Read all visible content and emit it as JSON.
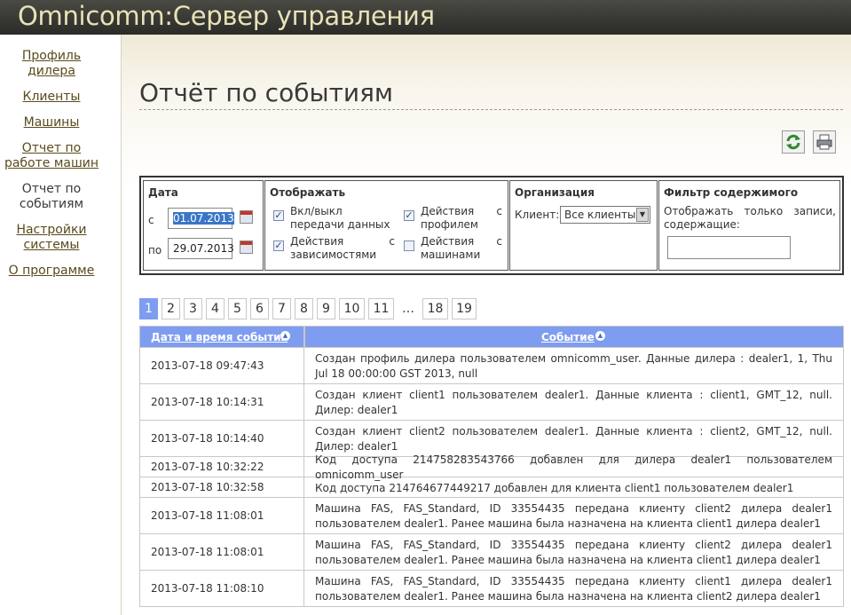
{
  "header": {
    "title": "Omnicomm:Сервер управления"
  },
  "sidebar": {
    "items": [
      {
        "label": "Профиль дилера"
      },
      {
        "label": "Клиенты"
      },
      {
        "label": "Машины"
      },
      {
        "label": "Отчет по работе машин"
      },
      {
        "label": "Отчет по событиям"
      },
      {
        "label": "Настройки системы"
      },
      {
        "label": "О программе"
      }
    ]
  },
  "page": {
    "title": "Отчёт по событиям"
  },
  "toolbar": {
    "refresh_icon": "refresh-icon",
    "print_icon": "print-icon"
  },
  "filters": {
    "date": {
      "heading": "Дата",
      "from_label": "с",
      "from_value": "01.07.2013",
      "to_label": "по",
      "to_value": "29.07.2013"
    },
    "display": {
      "heading": "Отображать",
      "options": [
        {
          "label": "Вкл/выкл передачи данных",
          "checked": true
        },
        {
          "label": "Действия с профилем",
          "checked": true
        },
        {
          "label": "Действия с зависимостями",
          "checked": true
        },
        {
          "label": "Действия с машинами",
          "checked": false
        }
      ]
    },
    "organization": {
      "heading": "Организация",
      "client_label": "Клиент:",
      "client_value": "Все клиенты"
    },
    "content": {
      "heading": "Фильтр содержимого",
      "description": "Отображать только записи, содержащие:",
      "value": ""
    }
  },
  "pagination": {
    "pages": [
      "1",
      "2",
      "3",
      "4",
      "5",
      "6",
      "7",
      "8",
      "9",
      "10",
      "11"
    ],
    "ellipsis": "…",
    "last_pages": [
      "18",
      "19"
    ],
    "current": "1"
  },
  "table": {
    "columns": [
      "Дата и время события",
      "Событие"
    ],
    "rows": [
      {
        "date": "2013-07-18 09:47:43",
        "event": "Создан профиль дилера пользователем omnicomm_user. Данные дилера : dealer1, 1, Thu Jul 18 00:00:00 GST 2013, null"
      },
      {
        "date": "2013-07-18 10:14:31",
        "event": "Создан клиент client1 пользователем dealer1. Данные клиента : client1, GMT_12, null. Дилер: dealer1"
      },
      {
        "date": "2013-07-18 10:14:40",
        "event": "Создан клиент client2 пользователем dealer1. Данные клиента : client2, GMT_12, null. Дилер: dealer1"
      },
      {
        "date": "2013-07-18 10:32:22",
        "event": "Код доступа 214758283543766 добавлен для дилера dealer1 пользователем omnicomm_user"
      },
      {
        "date": "2013-07-18 10:32:58",
        "event": "Код доступа 214764677449217 добавлен для клиента client1 пользователем dealer1"
      },
      {
        "date": "2013-07-18 11:08:01",
        "event": "Машина FAS, FAS_Standard, ID 33554435 передана клиенту client2 дилера dealer1 пользователем dealer1. Ранее машина была назначена на клиента client1 дилера dealer1"
      },
      {
        "date": "2013-07-18 11:08:01",
        "event": "Машина FAS, FAS_Standard, ID 33554435 передана клиенту client2 дилера dealer1 пользователем dealer1. Ранее машина была назначена на клиента client1 дилера dealer1"
      },
      {
        "date": "2013-07-18 11:08:10",
        "event": "Машина FAS, FAS_Standard, ID 33554435 передана клиенту client1 дилера dealer1 пользователем dealer1. Ранее машина была назначена на клиента client2 дилера dealer1"
      }
    ]
  }
}
